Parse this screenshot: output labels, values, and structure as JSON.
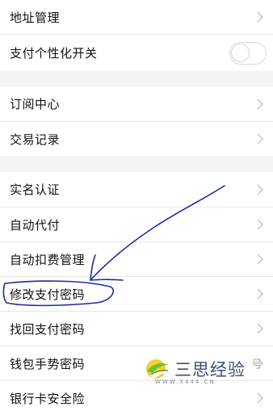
{
  "colors": {
    "background": "#f3f3f4",
    "row_background": "#ffffff",
    "text": "#111111",
    "chevron": "#c2c2c6",
    "divider": "#e7e7e8",
    "annotation_ink": "#1e2aa0"
  },
  "sections": [
    {
      "rows": [
        {
          "label": "地址管理",
          "accessory": "chevron-right-icon"
        },
        {
          "label": "支付个性化开关",
          "accessory": "toggle",
          "toggle_on": false
        }
      ]
    },
    {
      "rows": [
        {
          "label": "订阅中心",
          "accessory": "chevron-right-icon"
        },
        {
          "label": "交易记录",
          "accessory": "chevron-right-icon"
        }
      ]
    },
    {
      "rows": [
        {
          "label": "实名认证",
          "accessory": "chevron-right-icon"
        },
        {
          "label": "自动代付",
          "accessory": "chevron-right-icon"
        },
        {
          "label": "自动扣费管理",
          "accessory": "chevron-right-icon"
        },
        {
          "label": "修改支付密码",
          "accessory": "chevron-right-icon"
        },
        {
          "label": "找回支付密码",
          "accessory": "chevron-right-icon"
        },
        {
          "label": "钱包手势密码",
          "accessory": "chevron-right-icon"
        },
        {
          "label": "银行卡安全险",
          "accessory": "chevron-right-icon"
        }
      ]
    }
  ],
  "watermark": {
    "text": "三思经验",
    "url": "WWW.X444.CN",
    "icon": "logo-icon"
  },
  "partial_glyph": "号"
}
